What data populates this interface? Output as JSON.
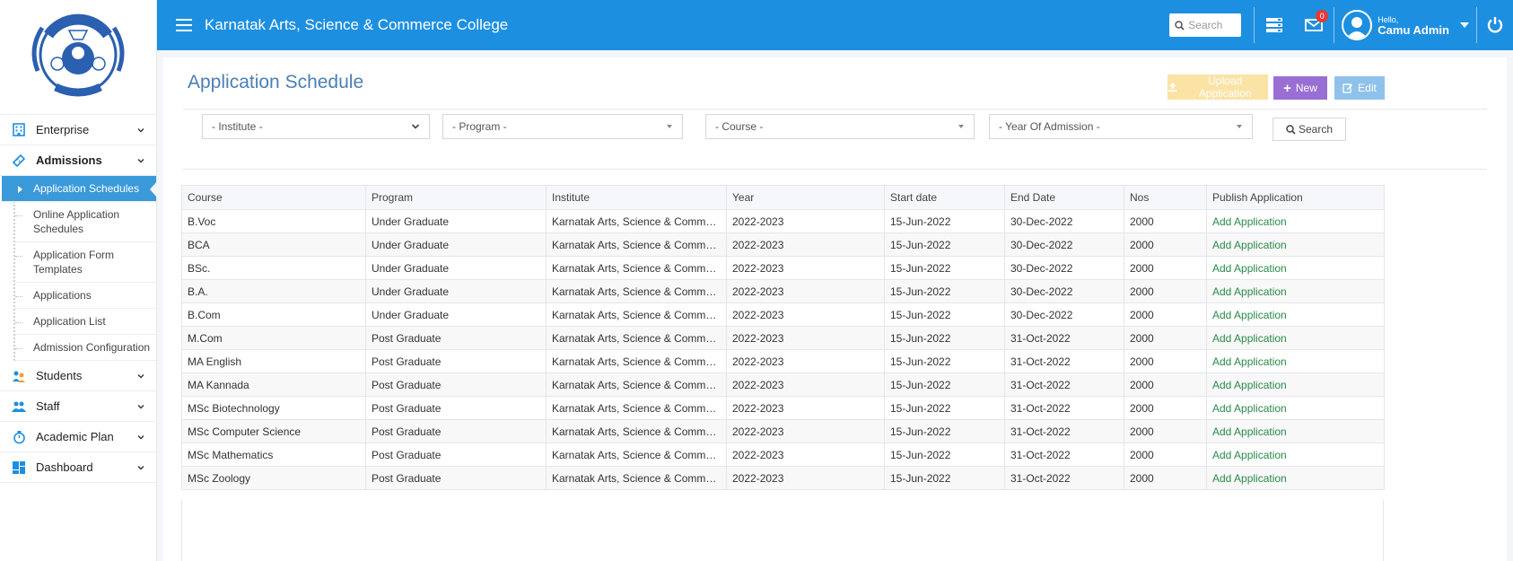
{
  "sidebar": {
    "menu_top": [
      {
        "label": "Enterprise"
      },
      {
        "label": "Admissions"
      }
    ],
    "admissions_sub": [
      {
        "label": "Application Schedules"
      },
      {
        "label": "Online Application Schedules"
      },
      {
        "label": "Application Form Templates"
      },
      {
        "label": "Applications"
      },
      {
        "label": "Application List"
      },
      {
        "label": "Admission Configuration"
      }
    ],
    "menu_bottom": [
      {
        "label": "Students"
      },
      {
        "label": "Staff"
      },
      {
        "label": "Academic Plan"
      },
      {
        "label": "Dashboard"
      }
    ]
  },
  "topbar": {
    "title": "Karnatak Arts, Science & Commerce College",
    "search_placeholder": "Search",
    "notification_count": "0",
    "greeting": "Hello,",
    "user_name": "Camu Admin"
  },
  "page": {
    "title": "Application Schedule",
    "upload_label": "Upload Application",
    "new_label": "New",
    "edit_label": "Edit",
    "filters": {
      "institute": "- Institute -",
      "program": "- Program -",
      "course": "- Course -",
      "year": "- Year Of Admission -"
    },
    "search_label": "Search"
  },
  "table": {
    "headers": [
      "Course",
      "Program",
      "Institute",
      "Year",
      "Start date",
      "End Date",
      "Nos",
      "Publish Application"
    ],
    "rows": [
      [
        "B.Voc",
        "Under Graduate",
        "Karnatak Arts, Science & Commer...",
        "2022-2023",
        "15-Jun-2022",
        "30-Dec-2022",
        "2000",
        "Add Application"
      ],
      [
        "BCA",
        "Under Graduate",
        "Karnatak Arts, Science & Commer...",
        "2022-2023",
        "15-Jun-2022",
        "30-Dec-2022",
        "2000",
        "Add Application"
      ],
      [
        "BSc.",
        "Under Graduate",
        "Karnatak Arts, Science & Commer...",
        "2022-2023",
        "15-Jun-2022",
        "30-Dec-2022",
        "2000",
        "Add Application"
      ],
      [
        "B.A.",
        "Under Graduate",
        "Karnatak Arts, Science & Commer...",
        "2022-2023",
        "15-Jun-2022",
        "30-Dec-2022",
        "2000",
        "Add Application"
      ],
      [
        "B.Com",
        "Under Graduate",
        "Karnatak Arts, Science & Commer...",
        "2022-2023",
        "15-Jun-2022",
        "30-Dec-2022",
        "2000",
        "Add Application"
      ],
      [
        "M.Com",
        "Post Graduate",
        "Karnatak Arts, Science & Commer...",
        "2022-2023",
        "15-Jun-2022",
        "31-Oct-2022",
        "2000",
        "Add Application"
      ],
      [
        "MA English",
        "Post Graduate",
        "Karnatak Arts, Science & Commer...",
        "2022-2023",
        "15-Jun-2022",
        "31-Oct-2022",
        "2000",
        "Add Application"
      ],
      [
        "MA Kannada",
        "Post Graduate",
        "Karnatak Arts, Science & Commer...",
        "2022-2023",
        "15-Jun-2022",
        "31-Oct-2022",
        "2000",
        "Add Application"
      ],
      [
        "MSc Biotechnology",
        "Post Graduate",
        "Karnatak Arts, Science & Commer...",
        "2022-2023",
        "15-Jun-2022",
        "31-Oct-2022",
        "2000",
        "Add Application"
      ],
      [
        "MSc Computer Science",
        "Post Graduate",
        "Karnatak Arts, Science & Commer...",
        "2022-2023",
        "15-Jun-2022",
        "31-Oct-2022",
        "2000",
        "Add Application"
      ],
      [
        "MSc Mathematics",
        "Post Graduate",
        "Karnatak Arts, Science & Commer...",
        "2022-2023",
        "15-Jun-2022",
        "31-Oct-2022",
        "2000",
        "Add Application"
      ],
      [
        "MSc Zoology",
        "Post Graduate",
        "Karnatak Arts, Science & Commer...",
        "2022-2023",
        "15-Jun-2022",
        "31-Oct-2022",
        "2000",
        "Add Application"
      ]
    ]
  },
  "colors": {
    "topbar": "#1d8fe0",
    "active_item": "#3a9ad9",
    "title": "#4a7fb5",
    "link": "#2a8a4a",
    "upload_btn": "#fbe3a6",
    "new_btn": "#9a6fd3",
    "edit_btn": "#8fc2ea"
  }
}
